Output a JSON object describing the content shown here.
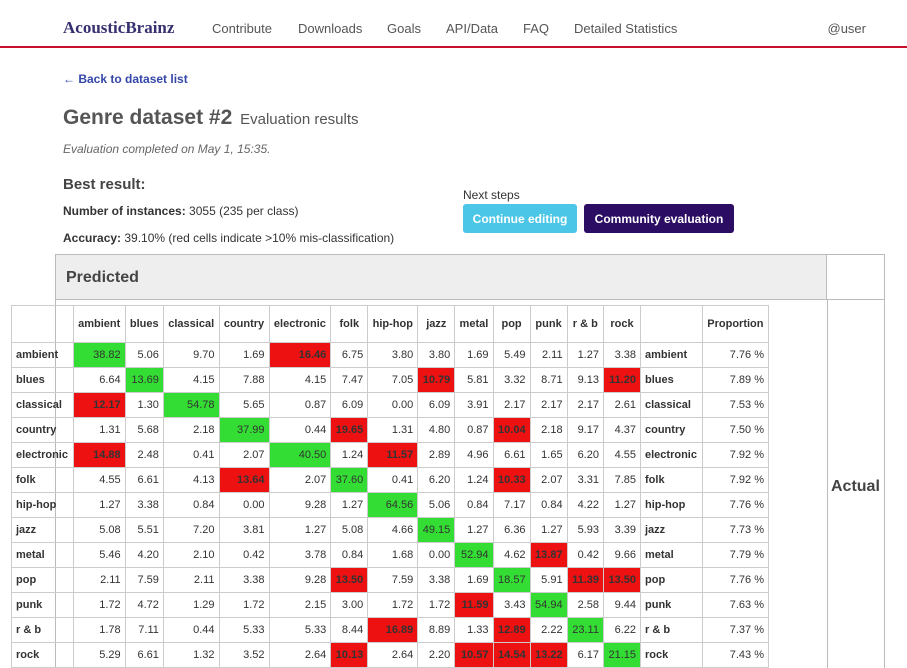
{
  "nav": {
    "brand": "AcousticBrainz",
    "items": [
      "Contribute",
      "Downloads",
      "Goals",
      "API/Data",
      "FAQ",
      "Detailed Statistics"
    ],
    "user": "@user"
  },
  "back_link": "← Back to dataset list",
  "title": {
    "main": "Genre dataset #2",
    "sub": "Evaluation results"
  },
  "eval_note": "Evaluation completed on May 1, 15:35.",
  "best": {
    "heading": "Best result:",
    "instances_label": "Number of instances:",
    "instances_value": "3055 (235 per class)",
    "accuracy_label": "Accuracy:",
    "accuracy_value": "39.10% (red cells indicate >10% mis-classification)"
  },
  "next_steps": {
    "label": "Next steps",
    "continue_editing": "Continue editing",
    "community_evaluation": "Community evaluation"
  },
  "matrix": {
    "predicted_label": "Predicted",
    "actual_label": "Actual",
    "proportion_label": "Proportion",
    "columns": [
      "ambient",
      "blues",
      "classical",
      "country",
      "electronic",
      "folk",
      "hip-hop",
      "jazz",
      "metal",
      "pop",
      "punk",
      "r & b",
      "rock"
    ],
    "colors": {
      "correct": "#33dd33",
      "misclassified": "#ee1111"
    },
    "rows": [
      {
        "label": "ambient",
        "values": [
          "38.82",
          "5.06",
          "9.70",
          "1.69",
          "16.46",
          "6.75",
          "3.80",
          "3.80",
          "1.69",
          "5.49",
          "2.11",
          "1.27",
          "3.38"
        ],
        "proportion": "7.76 %"
      },
      {
        "label": "blues",
        "values": [
          "6.64",
          "13.69",
          "4.15",
          "7.88",
          "4.15",
          "7.47",
          "7.05",
          "10.79",
          "5.81",
          "3.32",
          "8.71",
          "9.13",
          "11.20"
        ],
        "proportion": "7.89 %"
      },
      {
        "label": "classical",
        "values": [
          "12.17",
          "1.30",
          "54.78",
          "5.65",
          "0.87",
          "6.09",
          "0.00",
          "6.09",
          "3.91",
          "2.17",
          "2.17",
          "2.17",
          "2.61"
        ],
        "proportion": "7.53 %"
      },
      {
        "label": "country",
        "values": [
          "1.31",
          "5.68",
          "2.18",
          "37.99",
          "0.44",
          "19.65",
          "1.31",
          "4.80",
          "0.87",
          "10.04",
          "2.18",
          "9.17",
          "4.37"
        ],
        "proportion": "7.50 %"
      },
      {
        "label": "electronic",
        "values": [
          "14.88",
          "2.48",
          "0.41",
          "2.07",
          "40.50",
          "1.24",
          "11.57",
          "2.89",
          "4.96",
          "6.61",
          "1.65",
          "6.20",
          "4.55"
        ],
        "proportion": "7.92 %"
      },
      {
        "label": "folk",
        "values": [
          "4.55",
          "6.61",
          "4.13",
          "13.64",
          "2.07",
          "37.60",
          "0.41",
          "6.20",
          "1.24",
          "10.33",
          "2.07",
          "3.31",
          "7.85"
        ],
        "proportion": "7.92 %"
      },
      {
        "label": "hip-hop",
        "values": [
          "1.27",
          "3.38",
          "0.84",
          "0.00",
          "9.28",
          "1.27",
          "64.56",
          "5.06",
          "0.84",
          "7.17",
          "0.84",
          "4.22",
          "1.27"
        ],
        "proportion": "7.76 %"
      },
      {
        "label": "jazz",
        "values": [
          "5.08",
          "5.51",
          "7.20",
          "3.81",
          "1.27",
          "5.08",
          "4.66",
          "49.15",
          "1.27",
          "6.36",
          "1.27",
          "5.93",
          "3.39"
        ],
        "proportion": "7.73 %"
      },
      {
        "label": "metal",
        "values": [
          "5.46",
          "4.20",
          "2.10",
          "0.42",
          "3.78",
          "0.84",
          "1.68",
          "0.00",
          "52.94",
          "4.62",
          "13.87",
          "0.42",
          "9.66"
        ],
        "proportion": "7.79 %"
      },
      {
        "label": "pop",
        "values": [
          "2.11",
          "7.59",
          "2.11",
          "3.38",
          "9.28",
          "13.50",
          "7.59",
          "3.38",
          "1.69",
          "18.57",
          "5.91",
          "11.39",
          "13.50"
        ],
        "proportion": "7.76 %"
      },
      {
        "label": "punk",
        "values": [
          "1.72",
          "4.72",
          "1.29",
          "1.72",
          "2.15",
          "3.00",
          "1.72",
          "1.72",
          "11.59",
          "3.43",
          "54.94",
          "2.58",
          "9.44"
        ],
        "proportion": "7.63 %"
      },
      {
        "label": "r & b",
        "values": [
          "1.78",
          "7.11",
          "0.44",
          "5.33",
          "5.33",
          "8.44",
          "16.89",
          "8.89",
          "1.33",
          "12.89",
          "2.22",
          "23.11",
          "6.22"
        ],
        "proportion": "7.37 %"
      },
      {
        "label": "rock",
        "values": [
          "5.29",
          "6.61",
          "1.32",
          "3.52",
          "2.64",
          "10.13",
          "2.64",
          "2.20",
          "10.57",
          "14.54",
          "13.22",
          "6.17",
          "21.15"
        ],
        "proportion": "7.43 %"
      }
    ]
  }
}
